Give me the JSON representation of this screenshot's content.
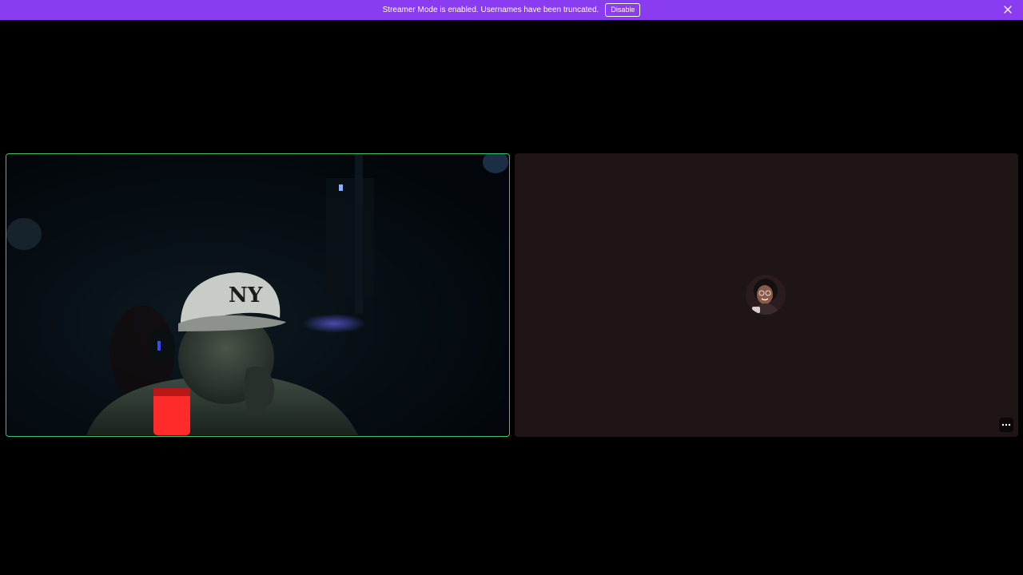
{
  "banner": {
    "message": "Streamer Mode is enabled. Usernames have been truncated.",
    "disable_label": "Disable",
    "background_color": "#8a3cf0",
    "close_icon": "close-icon"
  },
  "call": {
    "participants": [
      {
        "id": "participant-1",
        "video": "camera-on",
        "speaking": true,
        "speaking_border_color": "#3ec46d"
      },
      {
        "id": "participant-2",
        "video": "camera-off",
        "avatar": "user-avatar",
        "tile_color": "#201516",
        "more_icon": "more-options-icon"
      }
    ]
  }
}
